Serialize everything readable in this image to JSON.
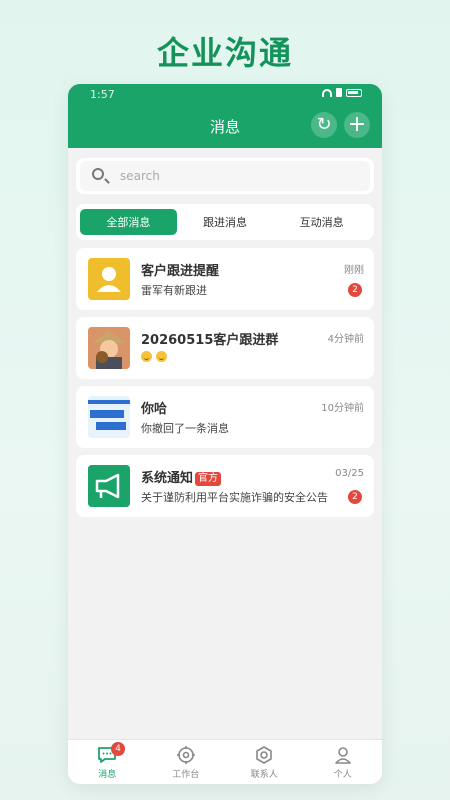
{
  "banner": {
    "title": "企业沟通"
  },
  "status_bar": {
    "time": "1:57"
  },
  "header": {
    "title": "消息"
  },
  "search": {
    "placeholder": "search"
  },
  "tabs": [
    {
      "label": "全部消息",
      "active": true
    },
    {
      "label": "跟进消息",
      "active": false
    },
    {
      "label": "互动消息",
      "active": false
    }
  ],
  "messages": [
    {
      "title": "客户跟进提醒",
      "subtitle": "雷军有新跟进",
      "time": "刚刚",
      "badge": "2",
      "avatar": "user-icon"
    },
    {
      "title": "20260515客户跟进群",
      "subtitle": "",
      "time": "4分钟前",
      "badge": "",
      "avatar": "group-avatar",
      "emojis": 2
    },
    {
      "title": "你哈",
      "subtitle": "你撤回了一条消息",
      "time": "10分钟前",
      "badge": "",
      "avatar": "photo-avatar"
    },
    {
      "title": "系统通知",
      "tag": "官方",
      "subtitle": "关于谨防利用平台实施诈骗的安全公告",
      "time": "03/25",
      "badge": "2",
      "avatar": "megaphone-icon"
    }
  ],
  "bottom_nav": [
    {
      "label": "消息",
      "active": true,
      "badge": "4"
    },
    {
      "label": "工作台",
      "active": false
    },
    {
      "label": "联系人",
      "active": false
    },
    {
      "label": "个人",
      "active": false
    }
  ],
  "colors": {
    "brand": "#1aa46a",
    "badge": "#e2483d",
    "banner": "#13935a"
  }
}
